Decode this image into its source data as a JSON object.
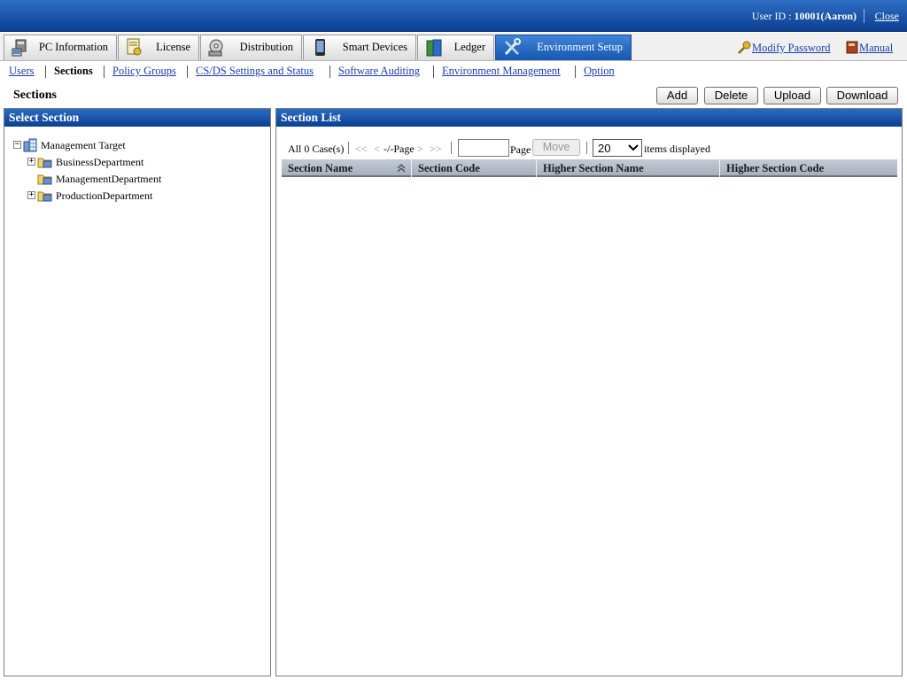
{
  "header": {
    "user_label": "User ID : ",
    "user_value": "10001(Aaron)",
    "close_label": "Close"
  },
  "tabs": [
    {
      "label": "PC Information",
      "icon": "pc-icon"
    },
    {
      "label": "License",
      "icon": "license-icon"
    },
    {
      "label": "Distribution",
      "icon": "distribution-icon"
    },
    {
      "label": "Smart Devices",
      "icon": "smart-device-icon"
    },
    {
      "label": "Ledger",
      "icon": "ledger-icon"
    },
    {
      "label": "Environment Setup",
      "icon": "tools-icon",
      "active": true
    }
  ],
  "toplinks": {
    "modify_password": "Modify Password",
    "manual": "Manual"
  },
  "subnav": [
    {
      "label": "Users"
    },
    {
      "label": "Sections",
      "current": true
    },
    {
      "label": "Policy Groups"
    },
    {
      "label": "CS/DS Settings and Status"
    },
    {
      "label": "Software Auditing"
    },
    {
      "label": "Environment Management"
    },
    {
      "label": "Option"
    }
  ],
  "page": {
    "title": "Sections",
    "buttons": {
      "add": "Add",
      "delete": "Delete",
      "upload": "Upload",
      "download": "Download"
    }
  },
  "left_panel": {
    "title": "Select Section",
    "tree": {
      "root": "Management Target",
      "children": [
        {
          "label": "BusinessDepartment",
          "expandable": true
        },
        {
          "label": "ManagementDepartment",
          "expandable": false
        },
        {
          "label": "ProductionDepartment",
          "expandable": true
        }
      ]
    }
  },
  "right_panel": {
    "title": "Section List",
    "pager": {
      "count": "All 0 Case(s)",
      "first": "<<",
      "prev": "<",
      "page_info": "-/-Page",
      "next": ">",
      "last": ">>",
      "page_input": "",
      "page_label": "Page",
      "move_button": "Move",
      "per_page": "20",
      "per_page_label": "items displayed"
    },
    "columns": [
      "Section Name",
      "Section Code",
      "Higher Section Name",
      "Higher Section Code"
    ]
  },
  "colors": {
    "header_blue": "#0b3f92",
    "link_blue": "#1a3ea8",
    "active_tab": "#1558b1"
  }
}
